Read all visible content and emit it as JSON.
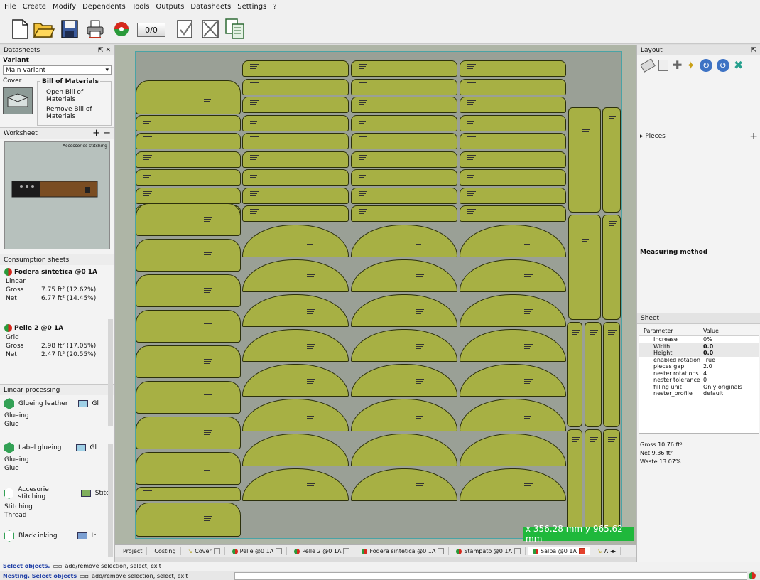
{
  "menu": [
    "File",
    "Create",
    "Modify",
    "Dependents",
    "Tools",
    "Outputs",
    "Datasheets",
    "Settings",
    "?"
  ],
  "toolbar": {
    "counter": "0/0",
    "icons": [
      "new-document-icon",
      "open-folder-icon",
      "save-disk-icon",
      "print-icon",
      "nest-disc-icon",
      "counter-display",
      "check-sheet-icon",
      "cross-sheet-icon",
      "copy-sheet-icon"
    ]
  },
  "left": {
    "title": "Datasheets",
    "title_controls": "⇱ ✕",
    "variant_label": "Variant",
    "variant_value": "Main variant",
    "cover_label": "Cover",
    "bom_label": "Bill of Materials",
    "bom_open": "Open Bill of Materials",
    "bom_remove": "Remove Bill of Materials",
    "worksheet_label": "Worksheet",
    "worksheet_controls": "+ −",
    "worksheet_caption": "Accessories stitching",
    "consumption_label": "Consumption sheets",
    "consumption": [
      {
        "name": "Fodera sintetica @0 1A",
        "type": "Linear",
        "rows": [
          {
            "k": "Gross",
            "v": "7.75 ft² (12.62%)"
          },
          {
            "k": "Net",
            "v": "6.77 ft² (14.45%)"
          }
        ]
      },
      {
        "name": "Pelle 2 @0 1A",
        "type": "Grid",
        "rows": [
          {
            "k": "Gross",
            "v": "2.98 ft² (17.05%)"
          },
          {
            "k": "Net",
            "v": "2.47 ft² (20.55%)"
          }
        ]
      }
    ],
    "linear_label": "Linear processing",
    "linear": [
      {
        "name": "Glueing leather",
        "tag": "Gl",
        "type": "Glueing",
        "sub": "Glue"
      },
      {
        "name": "Label glueing",
        "tag": "Gl",
        "type": "Glueing",
        "sub": "Glue"
      },
      {
        "name": "Accesorie stitching",
        "tag": "Stitc",
        "type": "Stitching",
        "sub": "Thread"
      },
      {
        "name": "Black inking",
        "tag": "Ir",
        "type": "",
        "sub": ""
      }
    ]
  },
  "canvas": {
    "coords": "x 356.28 mm  y 965.62 mm"
  },
  "tabs": [
    {
      "label": "Project",
      "closable": false,
      "active": false
    },
    {
      "label": "Costing",
      "closable": false,
      "active": false
    },
    {
      "label": "Cover",
      "closable": true,
      "active": false
    },
    {
      "label": "Pelle @0 1A",
      "closable": true,
      "active": false
    },
    {
      "label": "Pelle 2 @0 1A",
      "closable": true,
      "active": false
    },
    {
      "label": "Fodera sintetica @0 1A",
      "closable": true,
      "active": false
    },
    {
      "label": "Stampato @0 1A",
      "closable": true,
      "active": false
    },
    {
      "label": "Salpa @0 1A",
      "closable": true,
      "active": true
    },
    {
      "label": "A",
      "closable": false,
      "active": false
    }
  ],
  "right": {
    "title": "Layout",
    "pieces_label": "Pieces",
    "pieces_add": "+",
    "measuring_label": "Measuring method",
    "sheet_title": "Sheet",
    "param_header": "Parameter",
    "value_header": "Value",
    "params": [
      {
        "k": "Increase",
        "v": "0%"
      },
      {
        "k": "Width",
        "v": "0.0"
      },
      {
        "k": "Height",
        "v": "0.0"
      },
      {
        "k": "enabled rotation",
        "v": "True"
      },
      {
        "k": "pieces gap",
        "v": "2.0"
      },
      {
        "k": "nester rotations",
        "v": "4"
      },
      {
        "k": "nester tolerance",
        "v": "0"
      },
      {
        "k": "filling unit",
        "v": "Only originals"
      },
      {
        "k": "nester_profile",
        "v": "default"
      }
    ],
    "gross": "Gross  10.76 ft²",
    "net": "Net    9.36 ft²",
    "waste": "Waste  13.07%"
  },
  "status": {
    "line1_head": "Select objects.",
    "line1_rest": "add/remove selection,  select,  exit",
    "line2_head": "Nesting. Select objects",
    "line2_rest": "add/remove selection,  select,  exit"
  }
}
